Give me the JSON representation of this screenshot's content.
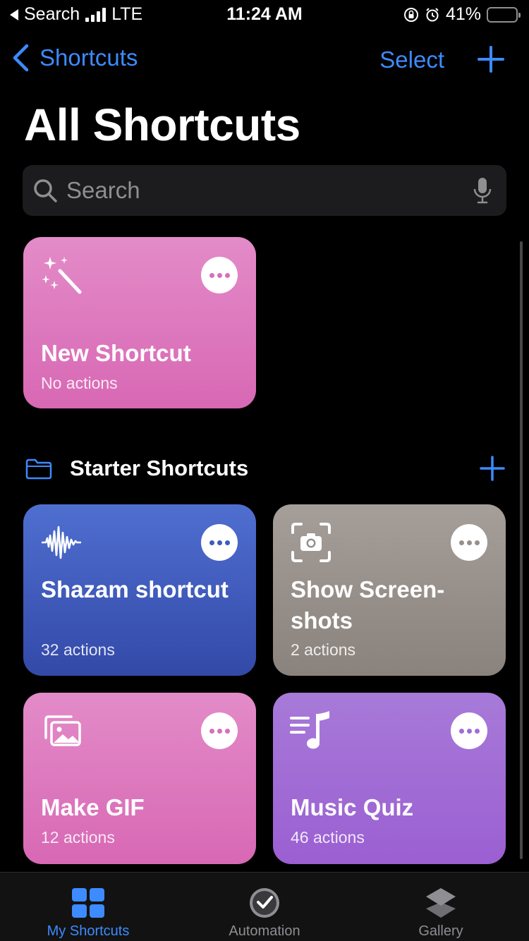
{
  "status_bar": {
    "back_label": "Search",
    "carrier": "LTE",
    "time": "11:24 AM",
    "battery_percent": "41%",
    "battery_level": 0.41
  },
  "nav": {
    "back_label": "Shortcuts",
    "select_label": "Select",
    "add_icon": "plus-icon"
  },
  "page_title": "All Shortcuts",
  "search": {
    "placeholder": "Search"
  },
  "cards": [
    {
      "title": "New Shortcut",
      "subtitle": "No actions",
      "icon": "magic-wand-icon",
      "color": "#de78be"
    },
    {
      "title": "Shazam shortcut",
      "subtitle": "32 actions",
      "icon": "waveform-icon",
      "color": "#3f5cbc"
    },
    {
      "title": "Show Screen-shots",
      "subtitle": "2 actions",
      "icon": "camera-viewfinder-icon",
      "color": "#978f8a"
    },
    {
      "title": "Make GIF",
      "subtitle": "12 actions",
      "icon": "photos-icon",
      "color": "#de78be"
    },
    {
      "title": "Music Quiz",
      "subtitle": "46 actions",
      "icon": "music-list-icon",
      "color": "#a16cd5"
    }
  ],
  "section": {
    "title": "Starter Shortcuts"
  },
  "tabs": [
    {
      "label": "My Shortcuts",
      "icon": "grid-icon",
      "active": true
    },
    {
      "label": "Automation",
      "icon": "clock-check-icon",
      "active": false
    },
    {
      "label": "Gallery",
      "icon": "layers-icon",
      "active": false
    }
  ],
  "colors": {
    "accent": "#3d8bff",
    "background": "#000000",
    "search_bg": "#1c1c1e",
    "tab_bar_bg": "#121212"
  }
}
